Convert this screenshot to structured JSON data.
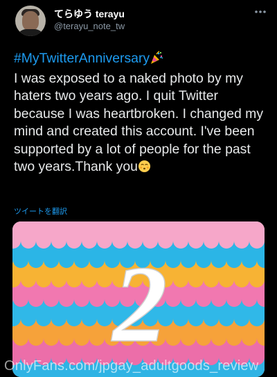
{
  "author": {
    "display_name": "てらゆう terayu",
    "handle": "@terayu_note_tw"
  },
  "tweet": {
    "hashtag": "#MyTwitterAnniversary",
    "hashtag_emoji": "party-popper-icon",
    "body": "I was exposed to a naked photo by my haters two years ago. I quit Twitter because I was heartbroken. I changed my mind and created this account. I've been supported by a lot of people for the past two years.Thank you",
    "end_emoji": "kissing-face-icon"
  },
  "translate_link": "ツイートを翻訳",
  "media": {
    "number": "2",
    "stripe_colors": [
      "#f6a7c9",
      "#2bb5e6",
      "#f7b334",
      "#f178b0",
      "#30b8e8",
      "#f6a23a",
      "#ec6ea9",
      "#2fb3e4"
    ]
  },
  "watermark": "OnlyFans.com/jpgay_adultgoods_review",
  "colors": {
    "accent": "#1d9bf0",
    "background": "#000000",
    "secondary_text": "#8b98a5"
  }
}
